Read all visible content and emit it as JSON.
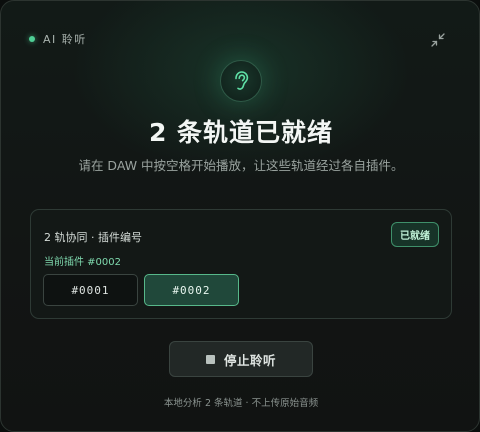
{
  "brand": {
    "label": "AI 聆听",
    "dot_color": "#4fcf96"
  },
  "header": {
    "collapse_icon": "collapse-icon",
    "ear_icon": "ear-icon"
  },
  "main": {
    "title": "2 条轨道已就绪",
    "subtitle": "请在 DAW 中按空格开始播放，让这些轨道经过各自插件。"
  },
  "card": {
    "label": "2 轨协同 · 插件编号",
    "current": "当前插件 #0002",
    "badge": "已就绪",
    "plugins": [
      {
        "label": "#0001",
        "selected": false
      },
      {
        "label": "#0002",
        "selected": true
      }
    ]
  },
  "actions": {
    "stop_label": "停止聆听",
    "stop_icon": "stop-icon"
  },
  "footer": {
    "text": "本地分析 2 条轨道 · 不上传原始音频"
  },
  "colors": {
    "accent": "#4fcf96",
    "accent_border": "#57b88a",
    "background": "#121514"
  }
}
